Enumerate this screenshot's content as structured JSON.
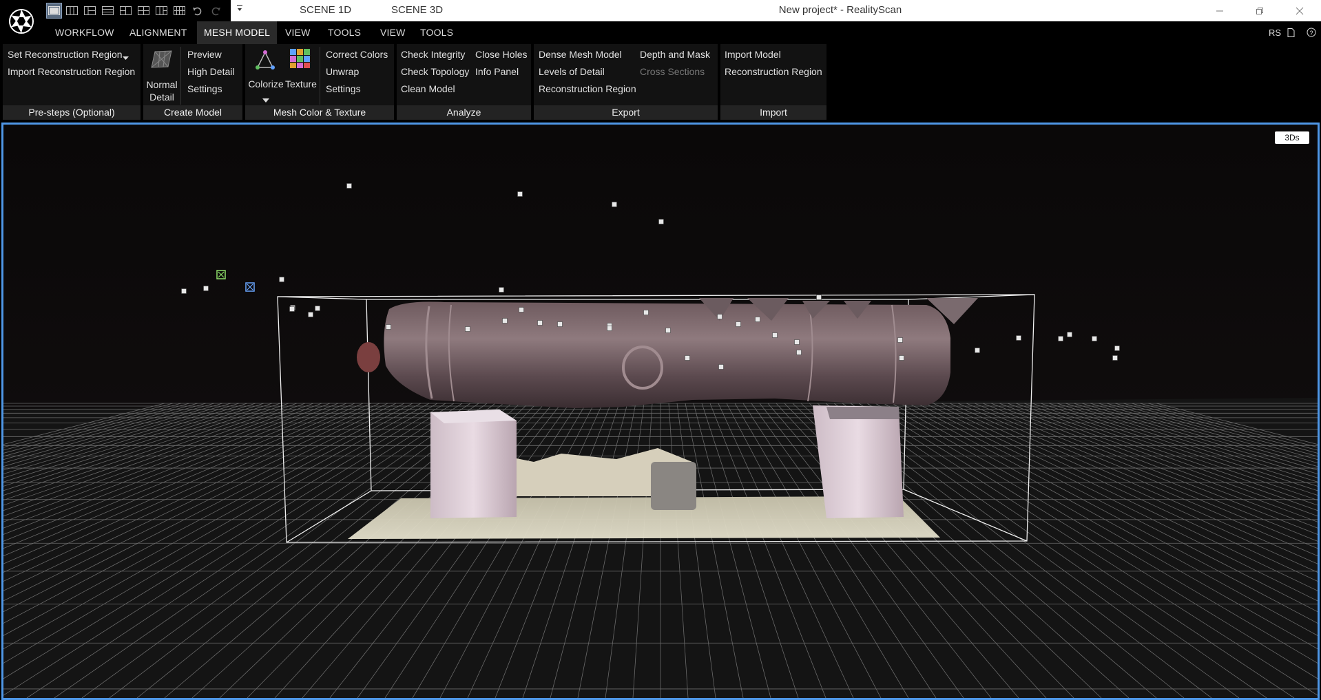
{
  "app": {
    "window_title": "New project* - RealityScan",
    "logo_icon": "realityscan-aperture-icon",
    "accent_color": "#4f97e6"
  },
  "quick_access": {
    "dropdown_icon": "chevron-down-icon",
    "layouts": [
      "layout-1-icon",
      "layout-2-icon",
      "layout-3-icon",
      "layout-4-icon",
      "layout-5-icon",
      "layout-6-icon",
      "layout-7-icon",
      "layout-8-icon"
    ],
    "undo_icon": "undo-icon",
    "redo_icon": "redo-icon"
  },
  "scene_tabs": [
    "SCENE 1D",
    "SCENE 3D"
  ],
  "menu": {
    "items": [
      "WORKFLOW",
      "ALIGNMENT",
      "MESH MODEL",
      "VIEW",
      "TOOLS",
      "VIEW",
      "TOOLS"
    ],
    "active": "MESH MODEL",
    "user": "RS"
  },
  "ribbon": {
    "groups": [
      {
        "label": "Pre-steps (Optional)",
        "items": [
          "Set Reconstruction Region",
          "Import Reconstruction Region"
        ]
      },
      {
        "label": "Create Model",
        "big_button": "Normal Detail",
        "big_button_line1": "Normal",
        "big_button_line2": "Detail",
        "items": [
          "Preview",
          "High Detail",
          "Settings"
        ]
      },
      {
        "label": "Mesh Color & Texture",
        "colorize": "Colorize",
        "texture": "Texture",
        "items": [
          "Correct Colors",
          "Unwrap",
          "Settings"
        ]
      },
      {
        "label": "Analyze",
        "items": [
          "Check Integrity",
          "Check Topology",
          "Clean Model",
          "Close Holes",
          "Info Panel"
        ]
      },
      {
        "label": "Export",
        "items": [
          "Dense Mesh Model",
          "Levels of Detail",
          "Reconstruction Region",
          "Depth and Mask",
          "Cross Sections"
        ],
        "disabled": [
          "Cross Sections"
        ]
      },
      {
        "label": "Import",
        "items": [
          "Import Model",
          "Reconstruction Region"
        ]
      }
    ]
  },
  "viewport": {
    "view_badge": "3Ds",
    "scene": "3D reconstruction of cannon on two stone supports inside reconstruction region box",
    "background_color": "#0b0b0b",
    "grid_color": "#6e6e6e",
    "box_color": "#ffffff"
  }
}
